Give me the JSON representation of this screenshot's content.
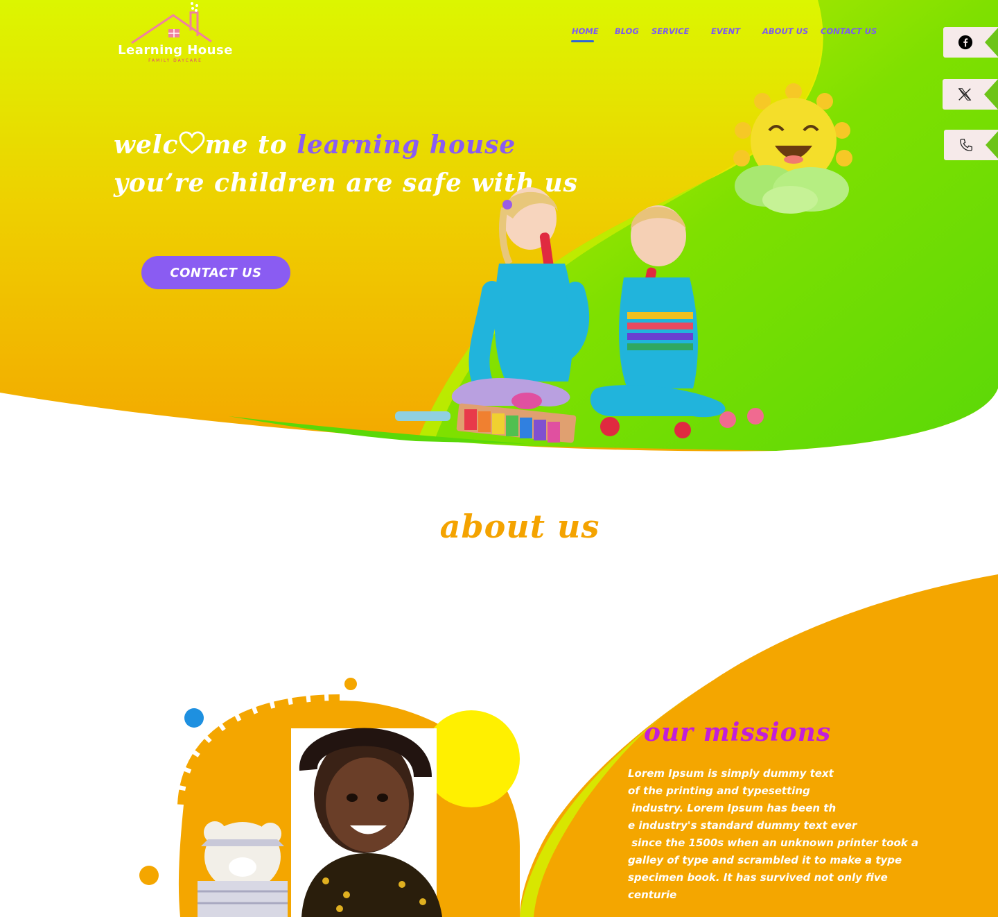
{
  "logo": {
    "name": "Learning House",
    "tagline": "FAMILY DAYCARE"
  },
  "nav": {
    "items": [
      {
        "label": "HOME",
        "active": true
      },
      {
        "label": "BLOG",
        "active": false
      },
      {
        "label": "SERVICE",
        "active": false
      },
      {
        "label": "EVENT",
        "active": false
      },
      {
        "label": "ABOUT US",
        "active": false
      },
      {
        "label": "CONTACT US",
        "active": false
      }
    ]
  },
  "social": [
    {
      "icon": "facebook-icon"
    },
    {
      "icon": "x-twitter-icon"
    },
    {
      "icon": "phone-icon"
    }
  ],
  "hero": {
    "line1_part1": "welc",
    "line1_part2": "me to ",
    "line1_highlight": "learning house",
    "line2": "you’re children are safe with us",
    "cta_label": "CONTACT US"
  },
  "about": {
    "title": "about us",
    "mission_title": "our missions",
    "mission_lines": [
      "Lorem Ipsum is simply dummy text",
      "of the printing and typesetting",
      " industry. Lorem Ipsum has been th",
      "e industry's standard dummy text ever",
      " since the 1500s when an unknown printer took a",
      "galley of type and scrambled it to make a type",
      "specimen book. It has survived not only five",
      "centurie"
    ]
  },
  "colors": {
    "yellow_green": "#dff200",
    "orange": "#f4a300",
    "green": "#5fd80a",
    "purple": "#8a5cf2",
    "magenta": "#c21fd8"
  }
}
